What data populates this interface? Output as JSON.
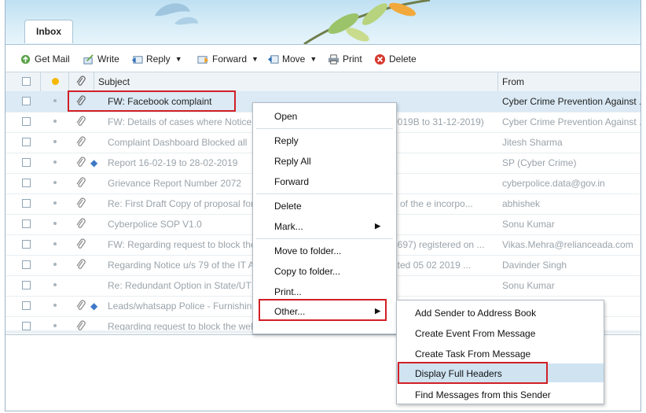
{
  "tab": {
    "label": "Inbox"
  },
  "toolbar": {
    "get_mail": "Get Mail",
    "write": "Write",
    "reply": "Reply",
    "forward": "Forward",
    "move": "Move",
    "print": "Print",
    "delete": "Delete"
  },
  "columns": {
    "subject": "Subject",
    "from": "From"
  },
  "messages": [
    {
      "subject": "FW: Facebook complaint",
      "from": "Cyber Crime Prevention Against ...",
      "extra": "",
      "selected": true
    },
    {
      "subject": "FW: Details of cases where Notice",
      "from": "Cyber Crime Prevention Against ...",
      "extra": "2019B to 31-12-2019)",
      "selected": false
    },
    {
      "subject": "Complaint Dashboard Blocked all",
      "from": "Jitesh Sharma",
      "extra": "",
      "selected": false
    },
    {
      "subject": "Report 16-02-19 to 28-02-2019",
      "from": "SP (Cyber Crime)",
      "extra": "",
      "selected": false
    },
    {
      "subject": "Grievance Report Number 2072",
      "from": "cyberpolice.data@gov.in",
      "extra": "",
      "selected": false
    },
    {
      "subject": "Re: First Draft Copy of proposal for",
      "from": "abhishek",
      "extra": "p of the e incorpo...",
      "selected": false
    },
    {
      "subject": "Cyberpolice SOP V1.0",
      "from": "Sonu Kumar",
      "extra": "",
      "selected": false
    },
    {
      "subject": "FW: Regarding request to block the",
      "from": "Vikas.Mehra@relianceada.com",
      "extra": "4697) registered on ...",
      "selected": false
    },
    {
      "subject": "Regarding Notice u/s 79 of the IT A",
      "from": "Davinder Singh",
      "extra": "ated 05 02 2019 ...",
      "selected": false
    },
    {
      "subject": "Re: Redundant Option in State/UT",
      "from": "Sonu Kumar",
      "extra": "",
      "selected": false
    },
    {
      "subject": "Leads/whatsapp Police - Furnishing",
      "from": "",
      "extra": "",
      "selected": false
    },
    {
      "subject": "Regarding request to block the website in Case/Complaint No. A/469",
      "from": "",
      "extra": "",
      "selected": false
    }
  ],
  "context_menu": {
    "open": "Open",
    "reply": "Reply",
    "reply_all": "Reply All",
    "forward": "Forward",
    "delete": "Delete",
    "mark": "Mark...",
    "move_to_folder": "Move to folder...",
    "copy_to_folder": "Copy to folder...",
    "print": "Print...",
    "other": "Other..."
  },
  "submenu": {
    "add_sender": "Add Sender to Address Book",
    "create_event": "Create Event From Message",
    "create_task": "Create Task From Message",
    "display_headers": "Display Full Headers",
    "find_messages": "Find Messages from this Sender"
  },
  "colors": {
    "accent": "#d21f26",
    "selection": "#dbeaf5",
    "header_bg": "#eef3f7"
  }
}
